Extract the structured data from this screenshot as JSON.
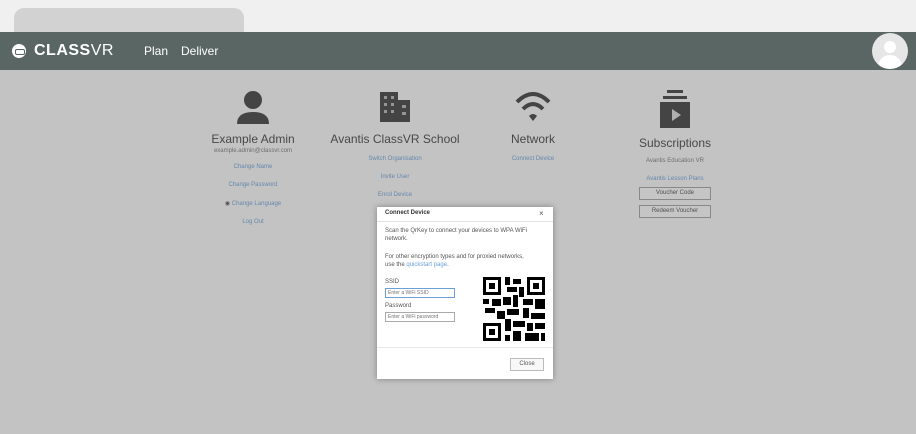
{
  "nav": {
    "logo_bold": "CLASS",
    "logo_light": "VR",
    "links": [
      "Plan",
      "Deliver"
    ]
  },
  "user": {
    "title": "Example Admin",
    "email": "example.admin@classvr.com",
    "links": [
      "Change Name",
      "Change Password",
      "Change Language",
      "Log Out"
    ]
  },
  "school": {
    "title": "Avantis ClassVR School",
    "links": [
      "Switch Organisation",
      "Invite User",
      "Enrol Device"
    ]
  },
  "network": {
    "title": "Network",
    "links": [
      "Connect Device"
    ]
  },
  "subscriptions": {
    "title": "Subscriptions",
    "sub": "Avantis Education VR",
    "link": "Avantis Lesson Plans",
    "buttons": [
      "Voucher Code",
      "Redeem Voucher"
    ]
  },
  "modal": {
    "title": "Connect Device",
    "close_x": "×",
    "text1": "Scan the QrKey to connect your devices to WPA WiFi network.",
    "text2_before": "For other encryption types and for proxied networks, use the",
    "text2_link": "quickstart page",
    "text2_after": ".",
    "ssid_label": "SSID",
    "ssid_placeholder": "Enter a WiFi SSID",
    "password_label": "Password",
    "password_placeholder": "Enter a WiFi password",
    "close_label": "Close"
  },
  "colors": {
    "navbar": "#5a6663",
    "link": "#7faad8"
  }
}
